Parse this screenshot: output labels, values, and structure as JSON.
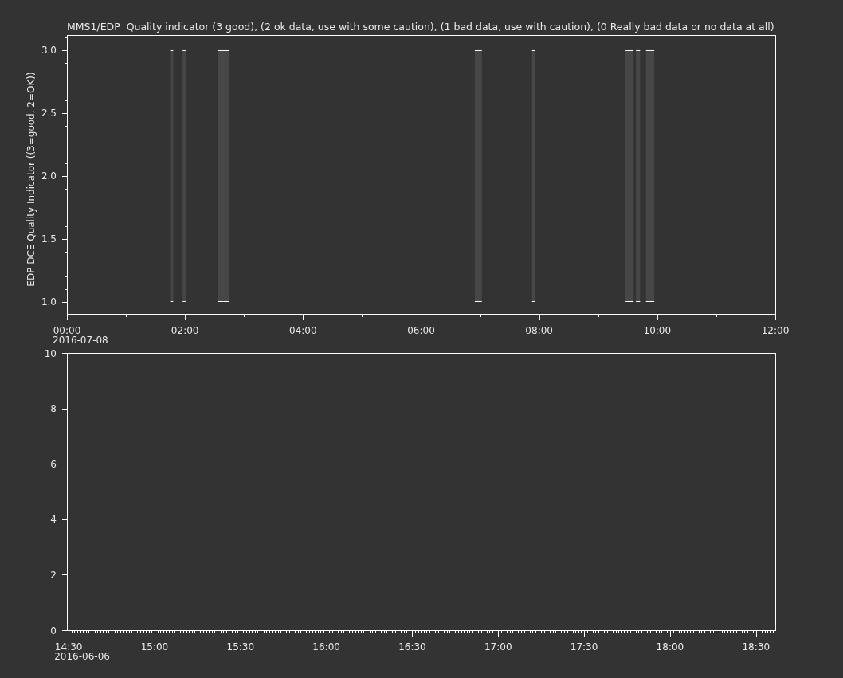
{
  "charts": [
    {
      "kind": "quality",
      "date_label": "2016-07-08",
      "chart_data": {
        "type": "bar",
        "title": "MMS1/EDP  Quality indicator (3 good), (2 ok data, use with some caution), (1 bad data, use with caution), (0 Really bad data or no data at all)",
        "ylabel": "EDP DCE Quality Indicator ((3=good, 2=OK))",
        "xlim": [
          0,
          12
        ],
        "ylim": [
          0.905,
          3.12
        ],
        "yticks": [
          {
            "value": 1,
            "label": "1.0"
          },
          {
            "value": 1.5,
            "label": "1.5"
          },
          {
            "value": 2,
            "label": "2.0"
          },
          {
            "value": 2.5,
            "label": "2.5"
          },
          {
            "value": 3,
            "label": "3.0"
          }
        ],
        "xticks": [
          {
            "value": 0,
            "label": "00:00"
          },
          {
            "value": 2,
            "label": "02:00"
          },
          {
            "value": 4,
            "label": "04:00"
          },
          {
            "value": 6,
            "label": "06:00"
          },
          {
            "value": 8,
            "label": "08:00"
          },
          {
            "value": 10,
            "label": "10:00"
          },
          {
            "value": 12,
            "label": "12:00"
          }
        ],
        "bands": [
          {
            "axis": "x",
            "from": 1.75,
            "to": 1.8
          },
          {
            "axis": "x",
            "from": 1.96,
            "to": 2.01
          },
          {
            "axis": "x",
            "from": 2.56,
            "to": 2.75
          },
          {
            "axis": "x",
            "from": 6.91,
            "to": 7.03
          },
          {
            "axis": "x",
            "from": 7.88,
            "to": 7.93
          },
          {
            "axis": "x",
            "from": 9.45,
            "to": 9.6
          },
          {
            "axis": "x",
            "from": 9.64,
            "to": 9.71
          },
          {
            "axis": "x",
            "from": 9.81,
            "to": 9.95
          }
        ]
      }
    },
    {
      "kind": "empty",
      "date_label": "2016-06-06",
      "chart_data": {
        "type": "line",
        "xlim": [
          14.49,
          18.6125
        ],
        "ylim": [
          0,
          10
        ],
        "yticks": [
          0,
          2,
          4,
          6,
          8,
          10
        ],
        "xticks": [
          {
            "value": 14.5,
            "label": "14:30"
          },
          {
            "value": 15,
            "label": "15:00"
          },
          {
            "value": 15.5,
            "label": "15:30"
          },
          {
            "value": 16,
            "label": "16:00"
          },
          {
            "value": 16.5,
            "label": "16:30"
          },
          {
            "value": 17,
            "label": "17:00"
          },
          {
            "value": 17.5,
            "label": "17:30"
          },
          {
            "value": 18,
            "label": "18:00"
          },
          {
            "value": 18.5,
            "label": "18:30"
          }
        ]
      }
    }
  ]
}
